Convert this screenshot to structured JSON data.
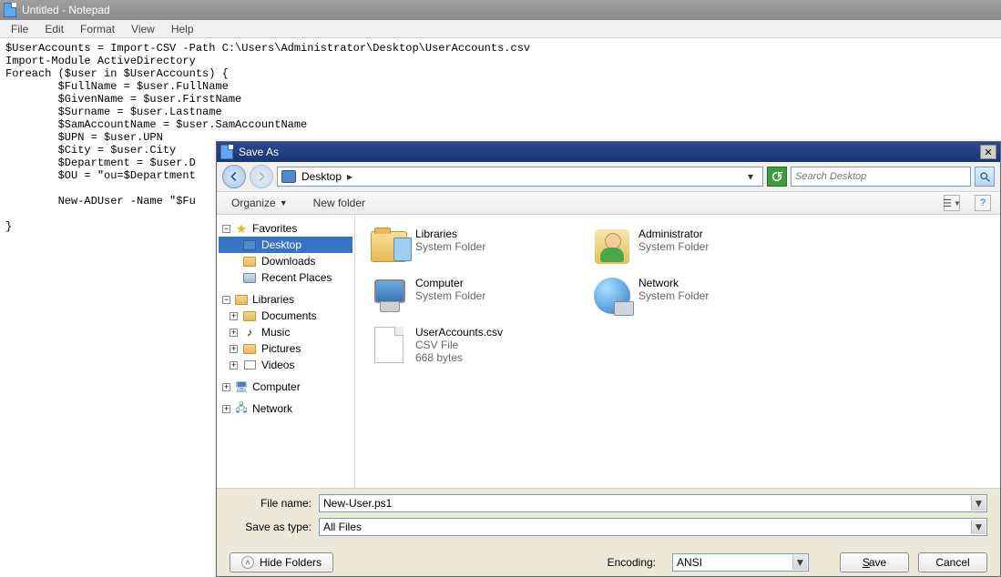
{
  "notepad": {
    "title": "Untitled - Notepad",
    "menu": [
      "File",
      "Edit",
      "Format",
      "View",
      "Help"
    ],
    "text": "$UserAccounts = Import-CSV -Path C:\\Users\\Administrator\\Desktop\\UserAccounts.csv\nImport-Module ActiveDirectory\nForeach ($user in $UserAccounts) {\n        $FullName = $user.FullName\n        $GivenName = $user.FirstName\n        $Surname = $user.Lastname\n        $SamAccountName = $user.SamAccountName\n        $UPN = $user.UPN\n        $City = $user.City\n        $Department = $user.D\n        $OU = \"ou=$Department\n\n        New-ADUser -Name \"$Fu\n\n}"
  },
  "dialog": {
    "title": "Save As",
    "location": "Desktop",
    "search_placeholder": "Search Desktop",
    "organize": "Organize",
    "newfolder": "New folder",
    "sidebar": {
      "favorites": {
        "label": "Favorites",
        "items": [
          "Desktop",
          "Downloads",
          "Recent Places"
        ],
        "selected": 0
      },
      "libraries": {
        "label": "Libraries",
        "items": [
          "Documents",
          "Music",
          "Pictures",
          "Videos"
        ]
      },
      "computer": {
        "label": "Computer"
      },
      "network": {
        "label": "Network"
      }
    },
    "items": [
      {
        "name": "Libraries",
        "line2": "System Folder",
        "icon": "libraries"
      },
      {
        "name": "Administrator",
        "line2": "System Folder",
        "icon": "user"
      },
      {
        "name": "Computer",
        "line2": "System Folder",
        "icon": "computer"
      },
      {
        "name": "Network",
        "line2": "System Folder",
        "icon": "network"
      },
      {
        "name": "UserAccounts.csv",
        "line2": "CSV File",
        "line3": "668 bytes",
        "icon": "file"
      }
    ],
    "file_name_label": "File name:",
    "file_name_value": "New-User.ps1",
    "save_type_label": "Save as type:",
    "save_type_value": "All Files",
    "encoding_label": "Encoding:",
    "encoding_value": "ANSI",
    "hide_folders": "Hide Folders",
    "save": "Save",
    "cancel": "Cancel"
  }
}
